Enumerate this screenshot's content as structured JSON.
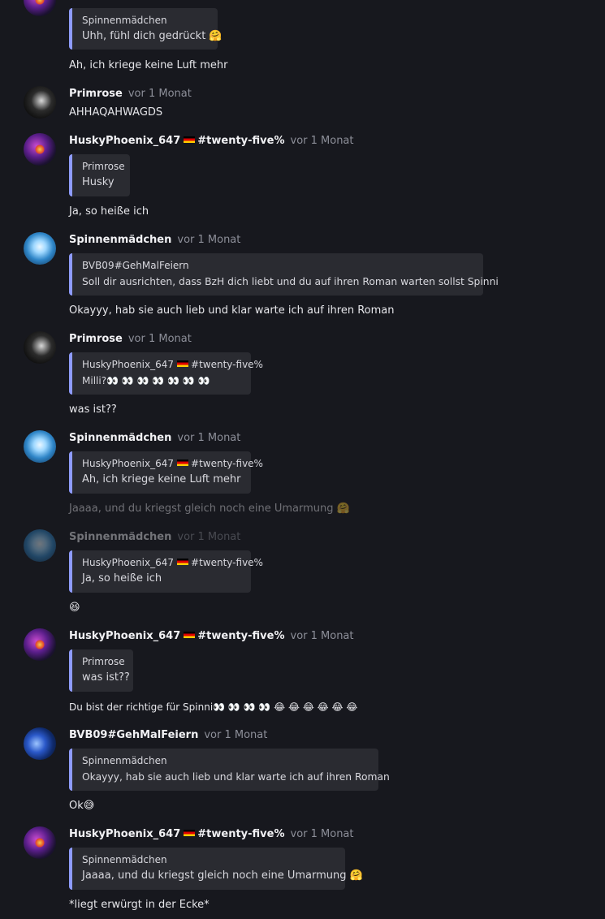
{
  "messages": [
    {
      "avatar_icon": "husky-phoenix-avatar-icon",
      "quote": {
        "author": "Spinnenmädchen",
        "text": "Uhh, fühl dich gedrückt 🤗"
      },
      "text": "Ah, ich kriege keine Luft mehr"
    },
    {
      "author": "Primrose",
      "time": "vor 1 Monat",
      "text": "AHHAQAHWAGDS"
    },
    {
      "author": "HuskyPhoenix_647",
      "tag": "#twenty-five%",
      "time": "vor 1 Monat",
      "quote": {
        "author": "Primrose",
        "text": "Husky"
      },
      "text": "Ja, so heiße ich"
    },
    {
      "author": "Spinnenmädchen",
      "time": "vor 1 Monat",
      "quote": {
        "author": "BVB09#GehMalFeiern",
        "text": "Soll dir ausrichten, dass BzH dich liebt und du auf ihren Roman warten sollst Spinni"
      },
      "text": "Okayyy, hab sie auch lieb und klar warte ich auf ihren Roman"
    },
    {
      "author": "Primrose",
      "time": "vor 1 Monat",
      "quote": {
        "author": "HuskyPhoenix_647",
        "author_tag": "#twenty-five%",
        "text": "Milli?👀 👀 👀 👀 👀 👀 👀"
      },
      "text": "was ist??"
    },
    {
      "author": "Spinnenmädchen",
      "time": "vor 1 Monat",
      "quote": {
        "author": "HuskyPhoenix_647",
        "author_tag": "#twenty-five%",
        "text": "Ah, ich kriege keine Luft mehr"
      },
      "text": "Jaaaa, und du kriegst gleich noch eine Umarmung 🤗"
    },
    {
      "author": "Spinnenmädchen",
      "time": "vor 1 Monat",
      "quote": {
        "author": "HuskyPhoenix_647",
        "author_tag": "#twenty-five%",
        "text": "Ja, so heiße ich"
      },
      "text": "😆"
    },
    {
      "author": "HuskyPhoenix_647",
      "tag": "#twenty-five%",
      "time": "vor 1 Monat",
      "quote": {
        "author": "Primrose",
        "text": "was ist??"
      },
      "text": "Du bist der richtige für Spinni👀 👀 👀 👀 😂 😂 😂 😂 😂 😂"
    },
    {
      "author": "BVB09#GehMalFeiern",
      "time": "vor 1 Monat",
      "quote": {
        "author": "Spinnenmädchen",
        "text": "Okayyy, hab sie auch lieb und klar warte ich auf ihren Roman"
      },
      "text": "Ok😅"
    },
    {
      "author": "HuskyPhoenix_647",
      "tag": "#twenty-five%",
      "time": "vor 1 Monat",
      "quote": {
        "author": "Spinnenmädchen",
        "text": "Jaaaa, und du kriegst gleich noch eine Umarmung 🤗"
      },
      "text": "*liegt erwürgt in der Ecke*"
    }
  ],
  "colors": {
    "background": "#17181e",
    "quote_bar": "#8e9bff",
    "quote_bg": "#2a2b31",
    "timestamp": "#8d8f99"
  }
}
